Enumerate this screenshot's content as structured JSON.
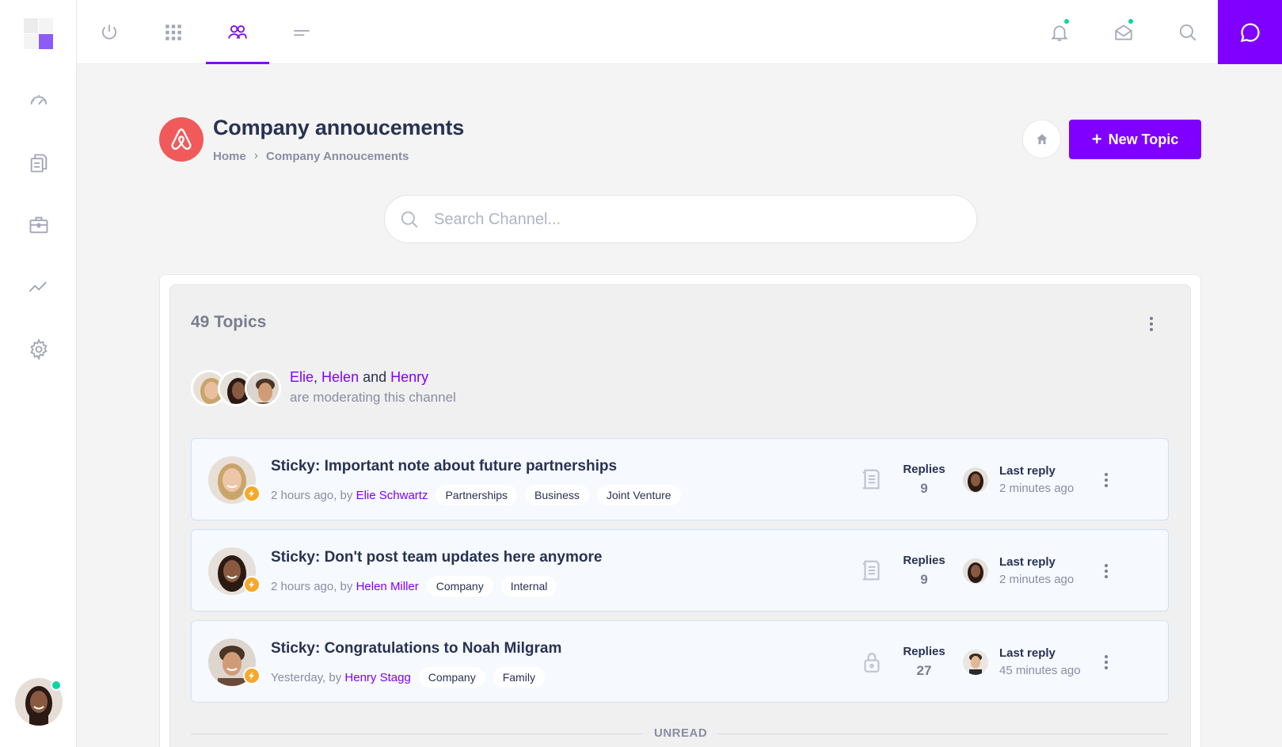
{
  "colors": {
    "accent": "#7f00ff",
    "online": "#06d6a0",
    "brand_channel": "#f05a5b",
    "badge": "#f7a82a"
  },
  "sidebar": {
    "items": [
      {
        "icon": "speedometer-icon"
      },
      {
        "icon": "documents-icon"
      },
      {
        "icon": "briefcase-icon"
      },
      {
        "icon": "trend-line-icon"
      },
      {
        "icon": "gear-icon"
      }
    ]
  },
  "topbar": {
    "tabs": [
      {
        "icon": "power-icon"
      },
      {
        "icon": "grid-icon"
      },
      {
        "icon": "users-icon",
        "active": true
      },
      {
        "icon": "menu-lines-icon"
      }
    ],
    "right_icons": [
      "bell-icon",
      "mail-icon",
      "search-icon",
      "chat-icon"
    ]
  },
  "header": {
    "title": "Company annoucements",
    "breadcrumb": [
      "Home",
      "Company Annoucements"
    ],
    "new_topic_label": "New Topic"
  },
  "search": {
    "placeholder": "Search Channel..."
  },
  "channel": {
    "topic_count": "49 Topics",
    "moderators": {
      "names": [
        "Elie",
        "Helen",
        "Henry"
      ],
      "joiner_comma": ",",
      "joiner_and": "and",
      "subtitle": "are moderating this channel"
    }
  },
  "topics": [
    {
      "title": "Sticky: Important note about future partnerships",
      "time": "2 hours ago, by",
      "author": "Elie Schwartz",
      "tags": [
        "Partnerships",
        "Business",
        "Joint Venture"
      ],
      "icon": "document-icon",
      "replies_label": "Replies",
      "replies": "9",
      "last_reply_label": "Last reply",
      "last_reply_time": "2 minutes ago"
    },
    {
      "title": "Sticky: Don't post team updates here anymore",
      "time": "2 hours ago, by",
      "author": "Helen Miller",
      "tags": [
        "Company",
        "Internal"
      ],
      "icon": "document-icon",
      "replies_label": "Replies",
      "replies": "9",
      "last_reply_label": "Last reply",
      "last_reply_time": "2 minutes ago"
    },
    {
      "title": "Sticky: Congratulations to Noah Milgram",
      "time": "Yesterday, by",
      "author": "Henry Stagg",
      "tags": [
        "Company",
        "Family"
      ],
      "icon": "lock-icon",
      "replies_label": "Replies",
      "replies": "27",
      "last_reply_label": "Last reply",
      "last_reply_time": "45 minutes ago"
    }
  ],
  "divider": {
    "label": "UNREAD"
  }
}
